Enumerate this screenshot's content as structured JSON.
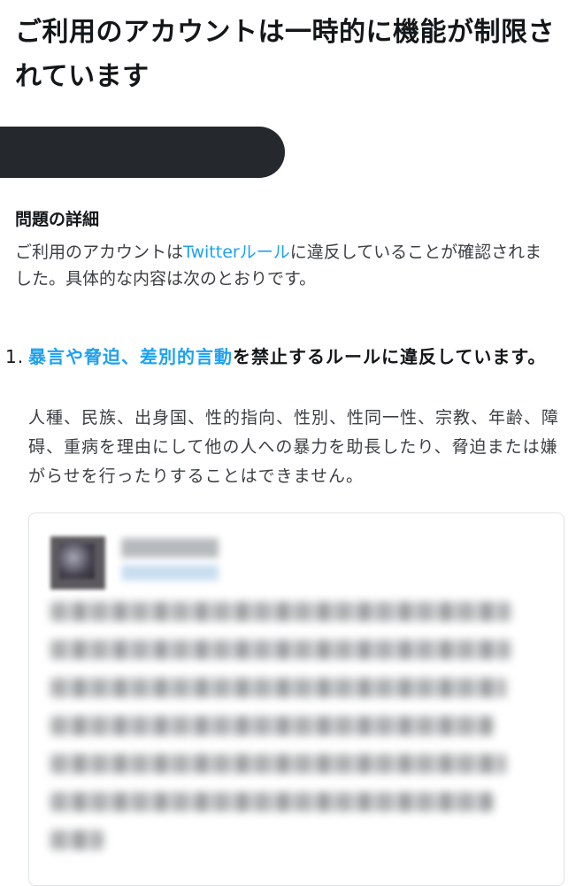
{
  "title": "ご利用のアカウントは一時的に機能が制限されています",
  "problem_details": {
    "heading": "問題の詳細",
    "text_before_link": "ご利用のアカウントは",
    "link_text": "Twitterルール",
    "text_after_link": "に違反していることが確認されました。具体的な内容は次のとおりです。"
  },
  "violation": {
    "number": "1.",
    "rule_link": "暴言や脅迫、差別的言動",
    "rule_suffix": "を禁止するルールに違反しています。",
    "description": "人種、民族、出身国、性的指向、性別、性同一性、宗教、年齢、障碍、重病を理由にして他の人への暴力を助長したり、脅迫または嫌がらせを行ったりすることはできません。"
  }
}
